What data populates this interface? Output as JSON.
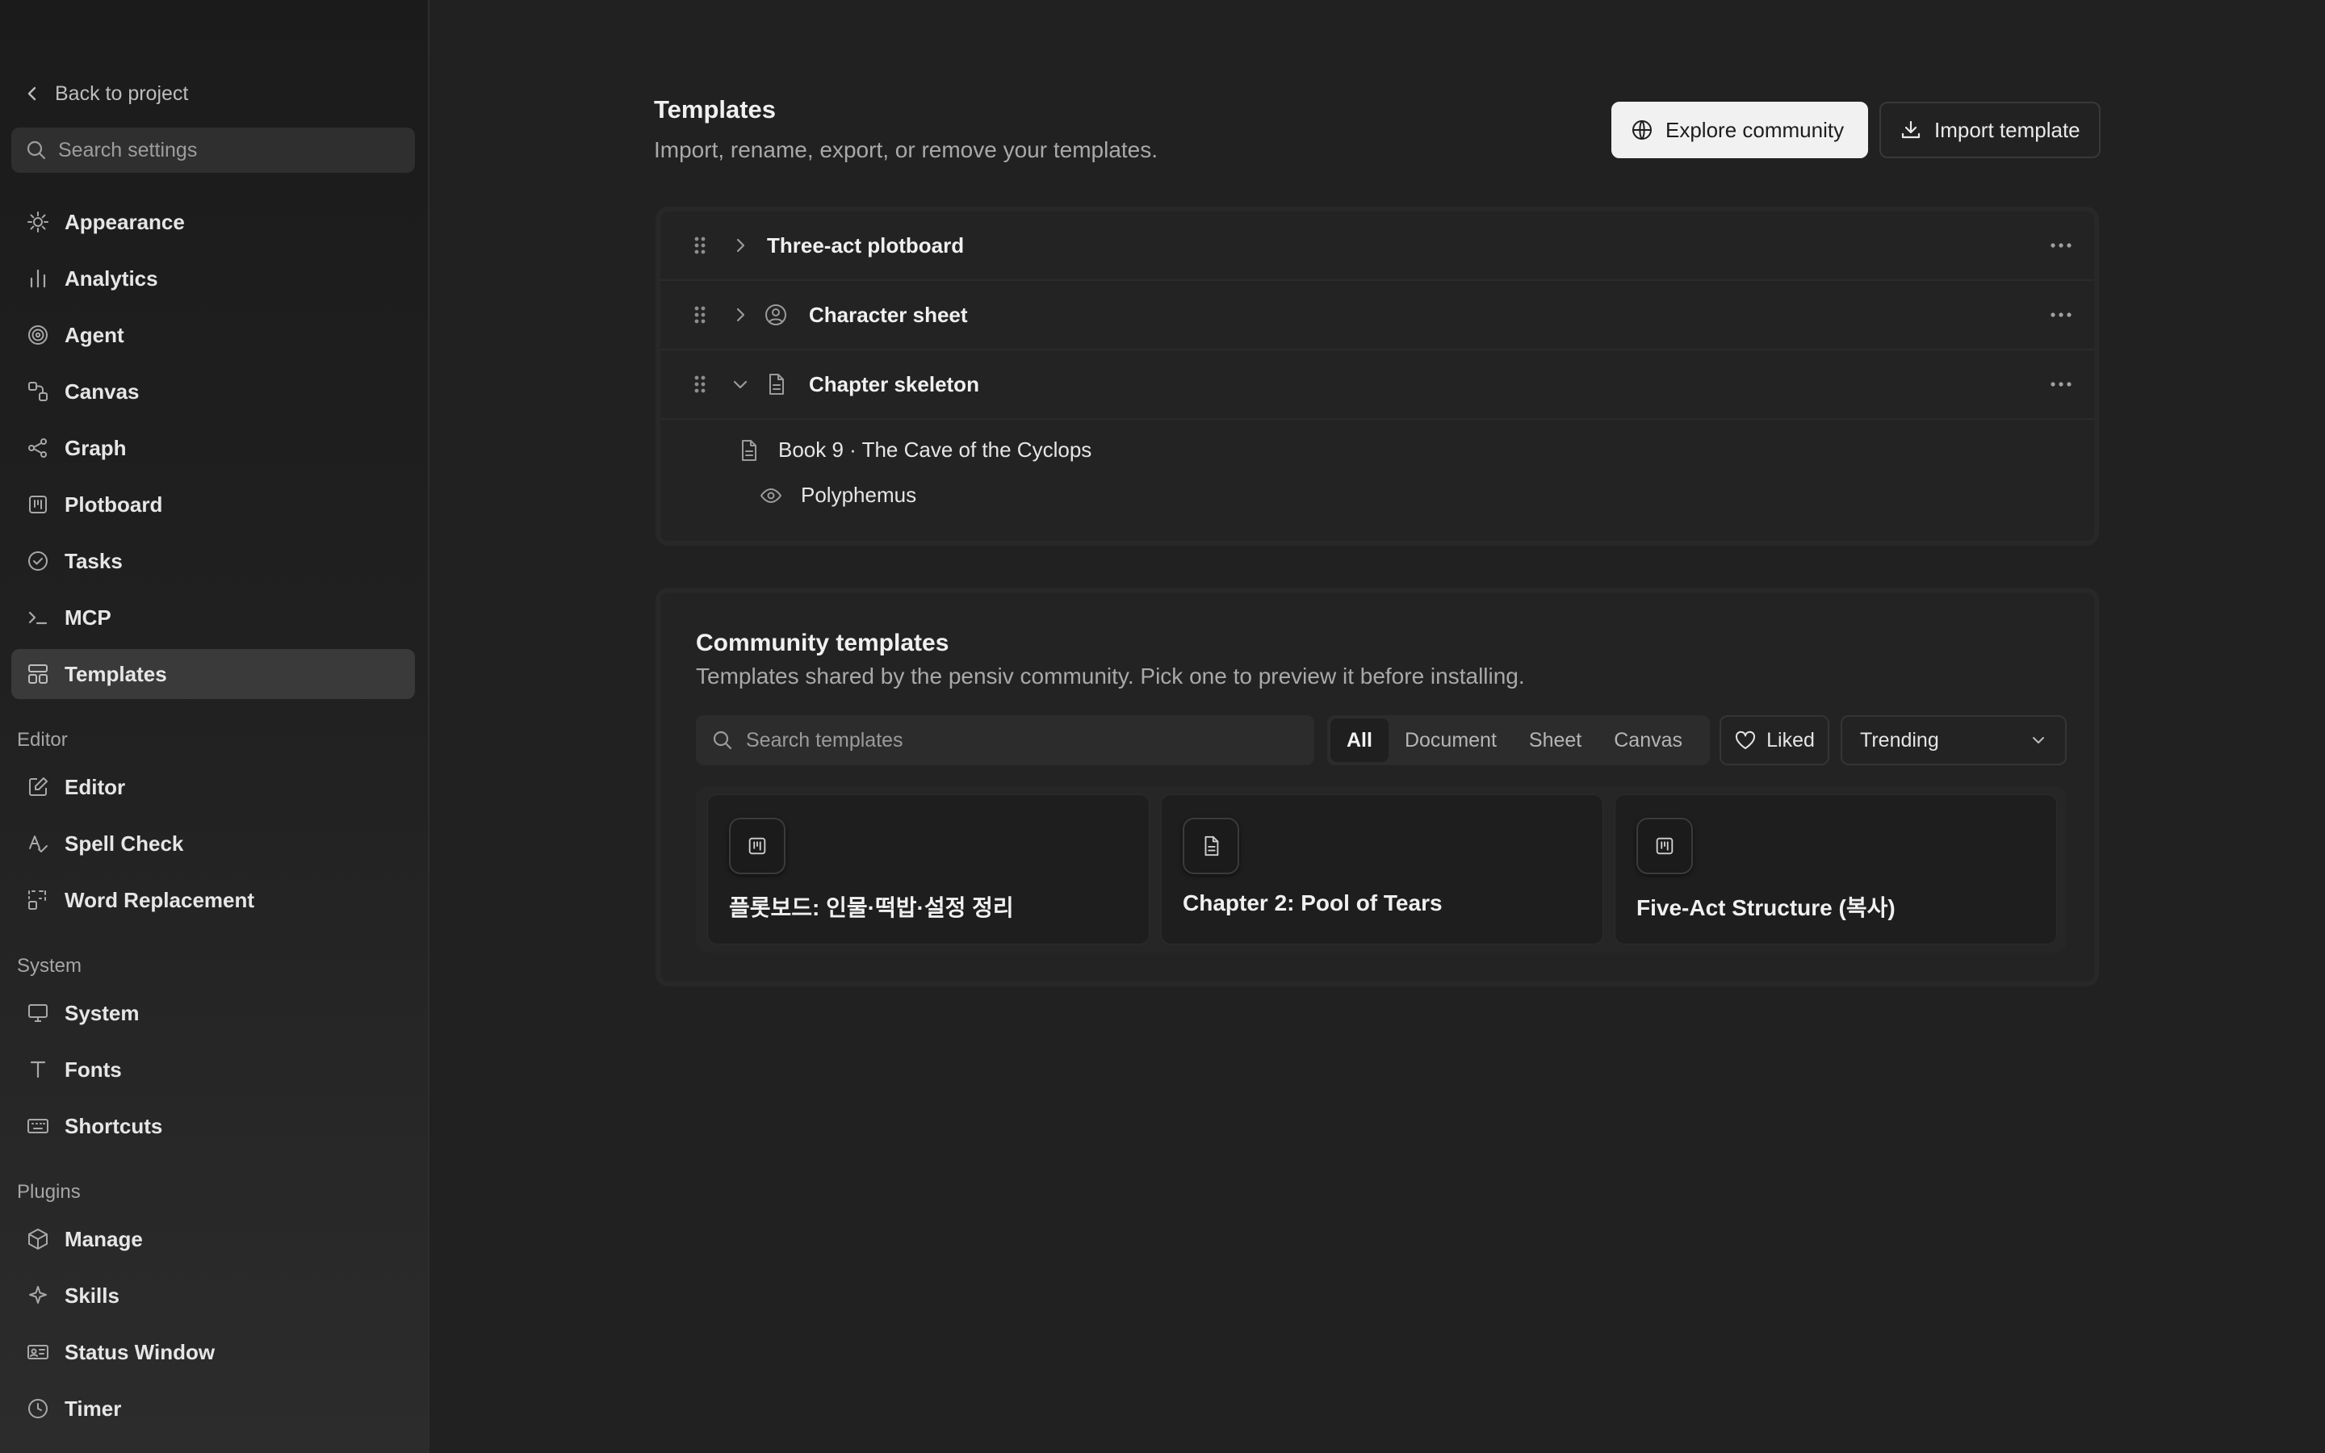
{
  "sidebar": {
    "back_label": "Back to project",
    "search_placeholder": "Search settings",
    "items": [
      {
        "label": "Appearance",
        "icon": "sun-icon"
      },
      {
        "label": "Analytics",
        "icon": "bar-chart-icon"
      },
      {
        "label": "Agent",
        "icon": "spiral-icon"
      },
      {
        "label": "Canvas",
        "icon": "canvas-icon"
      },
      {
        "label": "Graph",
        "icon": "graph-icon"
      },
      {
        "label": "Plotboard",
        "icon": "kanban-icon"
      },
      {
        "label": "Tasks",
        "icon": "check-circle-icon"
      },
      {
        "label": "MCP",
        "icon": "terminal-icon"
      },
      {
        "label": "Templates",
        "icon": "layout-icon",
        "active": true
      }
    ],
    "editor_section": {
      "label": "Editor",
      "items": [
        {
          "label": "Editor",
          "icon": "pencil-square-icon"
        },
        {
          "label": "Spell Check",
          "icon": "spell-check-icon"
        },
        {
          "label": "Word Replacement",
          "icon": "replace-icon"
        }
      ]
    },
    "system_section": {
      "label": "System",
      "items": [
        {
          "label": "System",
          "icon": "monitor-icon"
        },
        {
          "label": "Fonts",
          "icon": "type-icon"
        },
        {
          "label": "Shortcuts",
          "icon": "keyboard-icon"
        }
      ]
    },
    "plugins_section": {
      "label": "Plugins",
      "items": [
        {
          "label": "Manage",
          "icon": "package-icon"
        },
        {
          "label": "Skills",
          "icon": "sparkle-icon"
        },
        {
          "label": "Status Window",
          "icon": "id-card-icon"
        },
        {
          "label": "Timer",
          "icon": "clock-icon"
        }
      ]
    }
  },
  "main": {
    "title": "Templates",
    "subtitle": "Import, rename, export, or remove your templates.",
    "explore_label": "Explore community",
    "import_label": "Import template",
    "templates": [
      {
        "label": "Three-act plotboard",
        "expanded": false
      },
      {
        "label": "Character sheet",
        "expanded": false,
        "icon": "user-circle-icon"
      },
      {
        "label": "Chapter skeleton",
        "expanded": true,
        "icon": "document-icon",
        "children": [
          {
            "label": "Book 9 · The Cave of the Cyclops",
            "icon": "document-icon"
          },
          {
            "label": "Polyphemus",
            "icon": "eye-icon"
          }
        ]
      }
    ]
  },
  "community": {
    "title": "Community templates",
    "subtitle": "Templates shared by the pensiv community. Pick one to preview it before installing.",
    "search_placeholder": "Search templates",
    "filters": [
      "All",
      "Document",
      "Sheet",
      "Canvas"
    ],
    "active_filter": "All",
    "liked_label": "Liked",
    "sort_label": "Trending",
    "cards": [
      {
        "title": "플롯보드: 인물·떡밥·설정 정리",
        "icon": "kanban-icon"
      },
      {
        "title": "Chapter 2: Pool of Tears",
        "icon": "document-icon"
      },
      {
        "title": "Five-Act Structure (복사)",
        "icon": "kanban-icon"
      }
    ]
  }
}
